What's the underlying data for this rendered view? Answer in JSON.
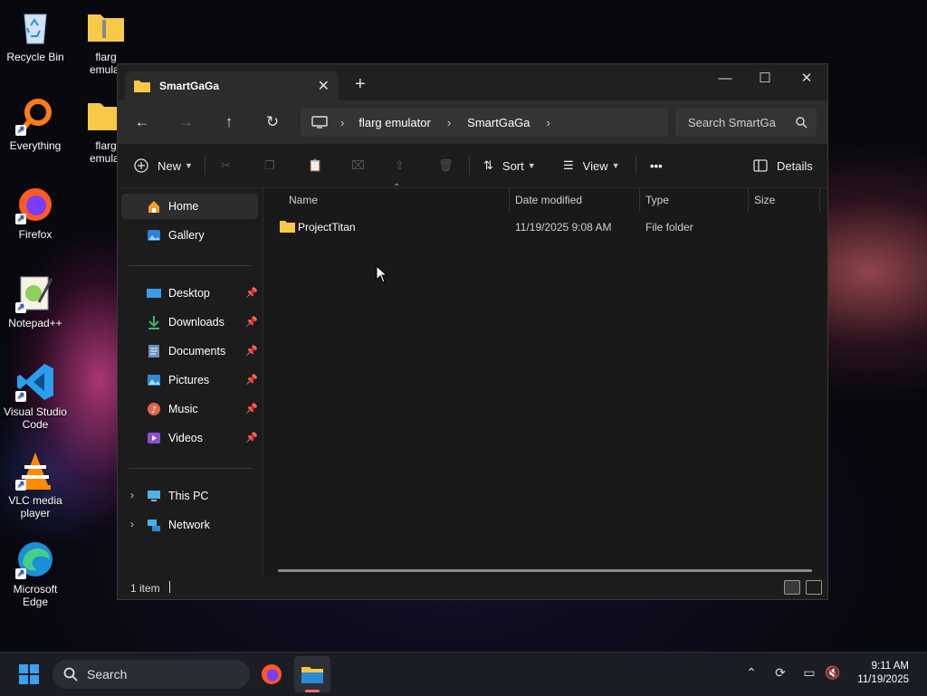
{
  "desktop": {
    "icons": [
      {
        "label": "Recycle Bin"
      },
      {
        "label": "flarg emulator",
        "display": "flarg\nemulat"
      },
      {
        "label": "Everything"
      },
      {
        "label": "flarg emulator",
        "display": "flarg\nemulat"
      },
      {
        "label": "Firefox"
      },
      {
        "label": "Notepad++"
      },
      {
        "label": "Visual Studio Code"
      },
      {
        "label": "VLC media player"
      },
      {
        "label": "Microsoft Edge"
      }
    ]
  },
  "explorer": {
    "tab_title": "SmartGaGa",
    "breadcrumb": [
      "flarg emulator",
      "SmartGaGa"
    ],
    "search_placeholder": "Search SmartGa",
    "toolbar": {
      "new_label": "New",
      "sort_label": "Sort",
      "view_label": "View",
      "more_label": "•••",
      "details_label": "Details"
    },
    "sidebar": {
      "home": "Home",
      "gallery": "Gallery",
      "quick_access": [
        {
          "label": "Desktop"
        },
        {
          "label": "Downloads"
        },
        {
          "label": "Documents"
        },
        {
          "label": "Pictures"
        },
        {
          "label": "Music"
        },
        {
          "label": "Videos"
        }
      ],
      "this_pc": "This PC",
      "network": "Network"
    },
    "columns": {
      "name": "Name",
      "date": "Date modified",
      "type": "Type",
      "size": "Size"
    },
    "files": [
      {
        "name": "ProjectTitan",
        "date": "11/19/2025 9:08 AM",
        "type": "File folder",
        "size": ""
      }
    ],
    "status": "1 item"
  },
  "taskbar": {
    "search_label": "Search",
    "time": "9:11 AM",
    "date": "11/19/2025"
  },
  "colors": {
    "accent": "#0078d4",
    "folder": "#f7c948"
  }
}
